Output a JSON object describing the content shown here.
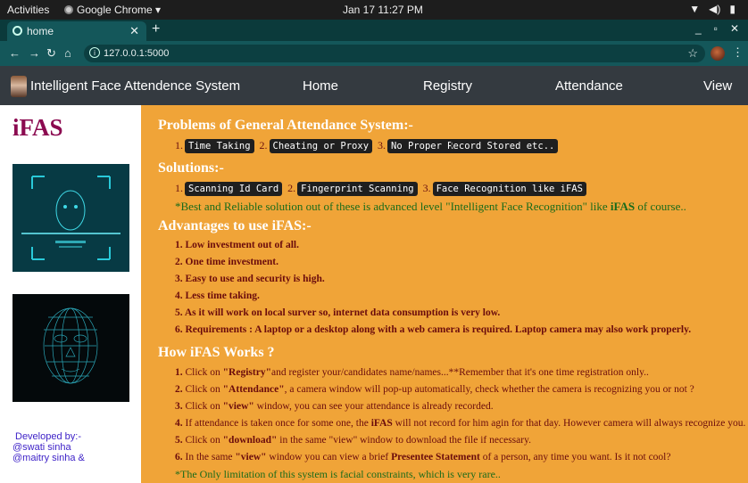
{
  "gnome": {
    "activities": "Activities",
    "app_name": "Google Chrome ▾",
    "datetime": "Jan 17  11:27 PM",
    "tray": [
      "▼",
      "◀)",
      "▮"
    ]
  },
  "browser": {
    "tab_title": "home",
    "url": "127.0.0.1:5000"
  },
  "nav": {
    "brand": "Intelligent Face Attendence System",
    "links": [
      "Home",
      "Registry",
      "Attendance",
      "View"
    ]
  },
  "sidebar": {
    "logo": "iFAS",
    "developed_by": "Developed by:-",
    "devs": [
      "@swati sinha",
      "@maitry sinha &"
    ]
  },
  "problems": {
    "heading": "Problems of General Attendance System:-",
    "items": [
      "Time Taking",
      "Cheating or Proxy",
      "No Proper Record Stored etc.."
    ]
  },
  "solutions": {
    "heading": "Solutions:-",
    "items": [
      "Scanning Id Card",
      "Fingerprint Scanning",
      "Face Recognition like iFAS"
    ],
    "note_prefix": "*Best and Reliable solution out of these is advanced level \"Intelligent Face Recognition\" like ",
    "note_bold": "iFAS",
    "note_suffix": " of course.."
  },
  "advantages": {
    "heading": "Advantages to use iFAS:-",
    "items": [
      "Low investment out of all.",
      "One time investment.",
      "Easy to use and security is high.",
      "Less time taking.",
      "As it will work on local surver so, internet data consumption is very low.",
      "Requirements : A laptop or a desktop along with a web camera is required. Laptop camera may also work properly."
    ]
  },
  "how": {
    "heading": "How iFAS Works ?",
    "items": [
      {
        "a": "Click on ",
        "b": "\"Registry\"",
        "c": "and register your/candidates name/names...**Remember that it's one time registration only.."
      },
      {
        "a": "Click on ",
        "b": "\"Attendance\"",
        "c": ", a camera window will pop-up automatically, check whether the camera is recognizing you or not ?"
      },
      {
        "a": "Click on ",
        "b": "\"view\"",
        "c": " window, you can see your attendance is already recorded."
      },
      {
        "a": "If attendance is taken once for some one, the ",
        "b": "iFAS",
        "c": " will not record for him agin for that day. However camera will always recognize you."
      },
      {
        "a": "Click on ",
        "b": "\"download\"",
        "c": " in the same \"view\" window to download the file if necessary."
      },
      {
        "a": "In the same ",
        "b": "\"view\"",
        "c": " window you can view a brief ",
        "d": "Presentee Statement",
        "e": " of a person, any time you want. Is it not cool?"
      }
    ],
    "limitation": "*The Only limitation of this system is facial constraints, which is very rare.."
  }
}
